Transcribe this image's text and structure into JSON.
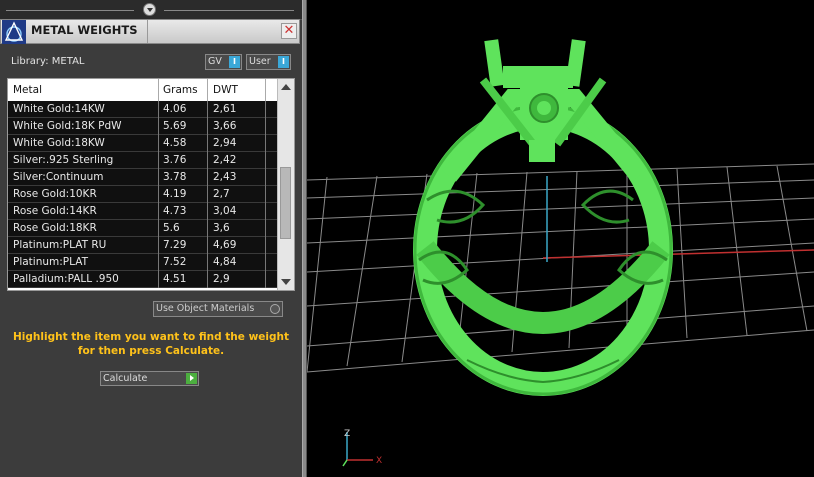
{
  "panel": {
    "title": "METAL WEIGHTS",
    "close_glyph": "✕",
    "library_label": "Library: METAL",
    "toggles": [
      {
        "label": "GV",
        "indicator": "I"
      },
      {
        "label": "User",
        "indicator": "I"
      }
    ],
    "table": {
      "columns": [
        "Metal",
        "Grams",
        "DWT"
      ],
      "rows": [
        {
          "metal": "White Gold:14KW",
          "grams": "4.06",
          "dwt": "2,61"
        },
        {
          "metal": "White Gold:18K PdW",
          "grams": "5.69",
          "dwt": "3,66"
        },
        {
          "metal": "White Gold:18KW",
          "grams": "4.58",
          "dwt": "2,94"
        },
        {
          "metal": "Silver:.925 Sterling",
          "grams": "3.76",
          "dwt": "2,42"
        },
        {
          "metal": "Silver:Continuum",
          "grams": "3.78",
          "dwt": "2,43"
        },
        {
          "metal": "Rose Gold:10KR",
          "grams": "4.19",
          "dwt": "2,7"
        },
        {
          "metal": "Rose Gold:14KR",
          "grams": "4.73",
          "dwt": "3,04"
        },
        {
          "metal": "Rose Gold:18KR",
          "grams": "5.6",
          "dwt": "3,6"
        },
        {
          "metal": "Platinum:PLAT RU",
          "grams": "7.29",
          "dwt": "4,69"
        },
        {
          "metal": "Platinum:PLAT",
          "grams": "7.52",
          "dwt": "4,84"
        },
        {
          "metal": "Palladium:PALL .950",
          "grams": "4.51",
          "dwt": "2,9"
        }
      ]
    },
    "use_object_materials_label": "Use Object Materials",
    "instruction": "Highlight the item you want to find the weight for then press Calculate.",
    "calculate_label": "Calculate"
  },
  "viewport": {
    "axis_labels": {
      "z": "Z",
      "x": "X"
    },
    "model_color": "#5fe35c",
    "grid_color": "#8a8a8a",
    "x_axis_color": "#c03030",
    "y_axis_color": "#3aa8c8"
  }
}
